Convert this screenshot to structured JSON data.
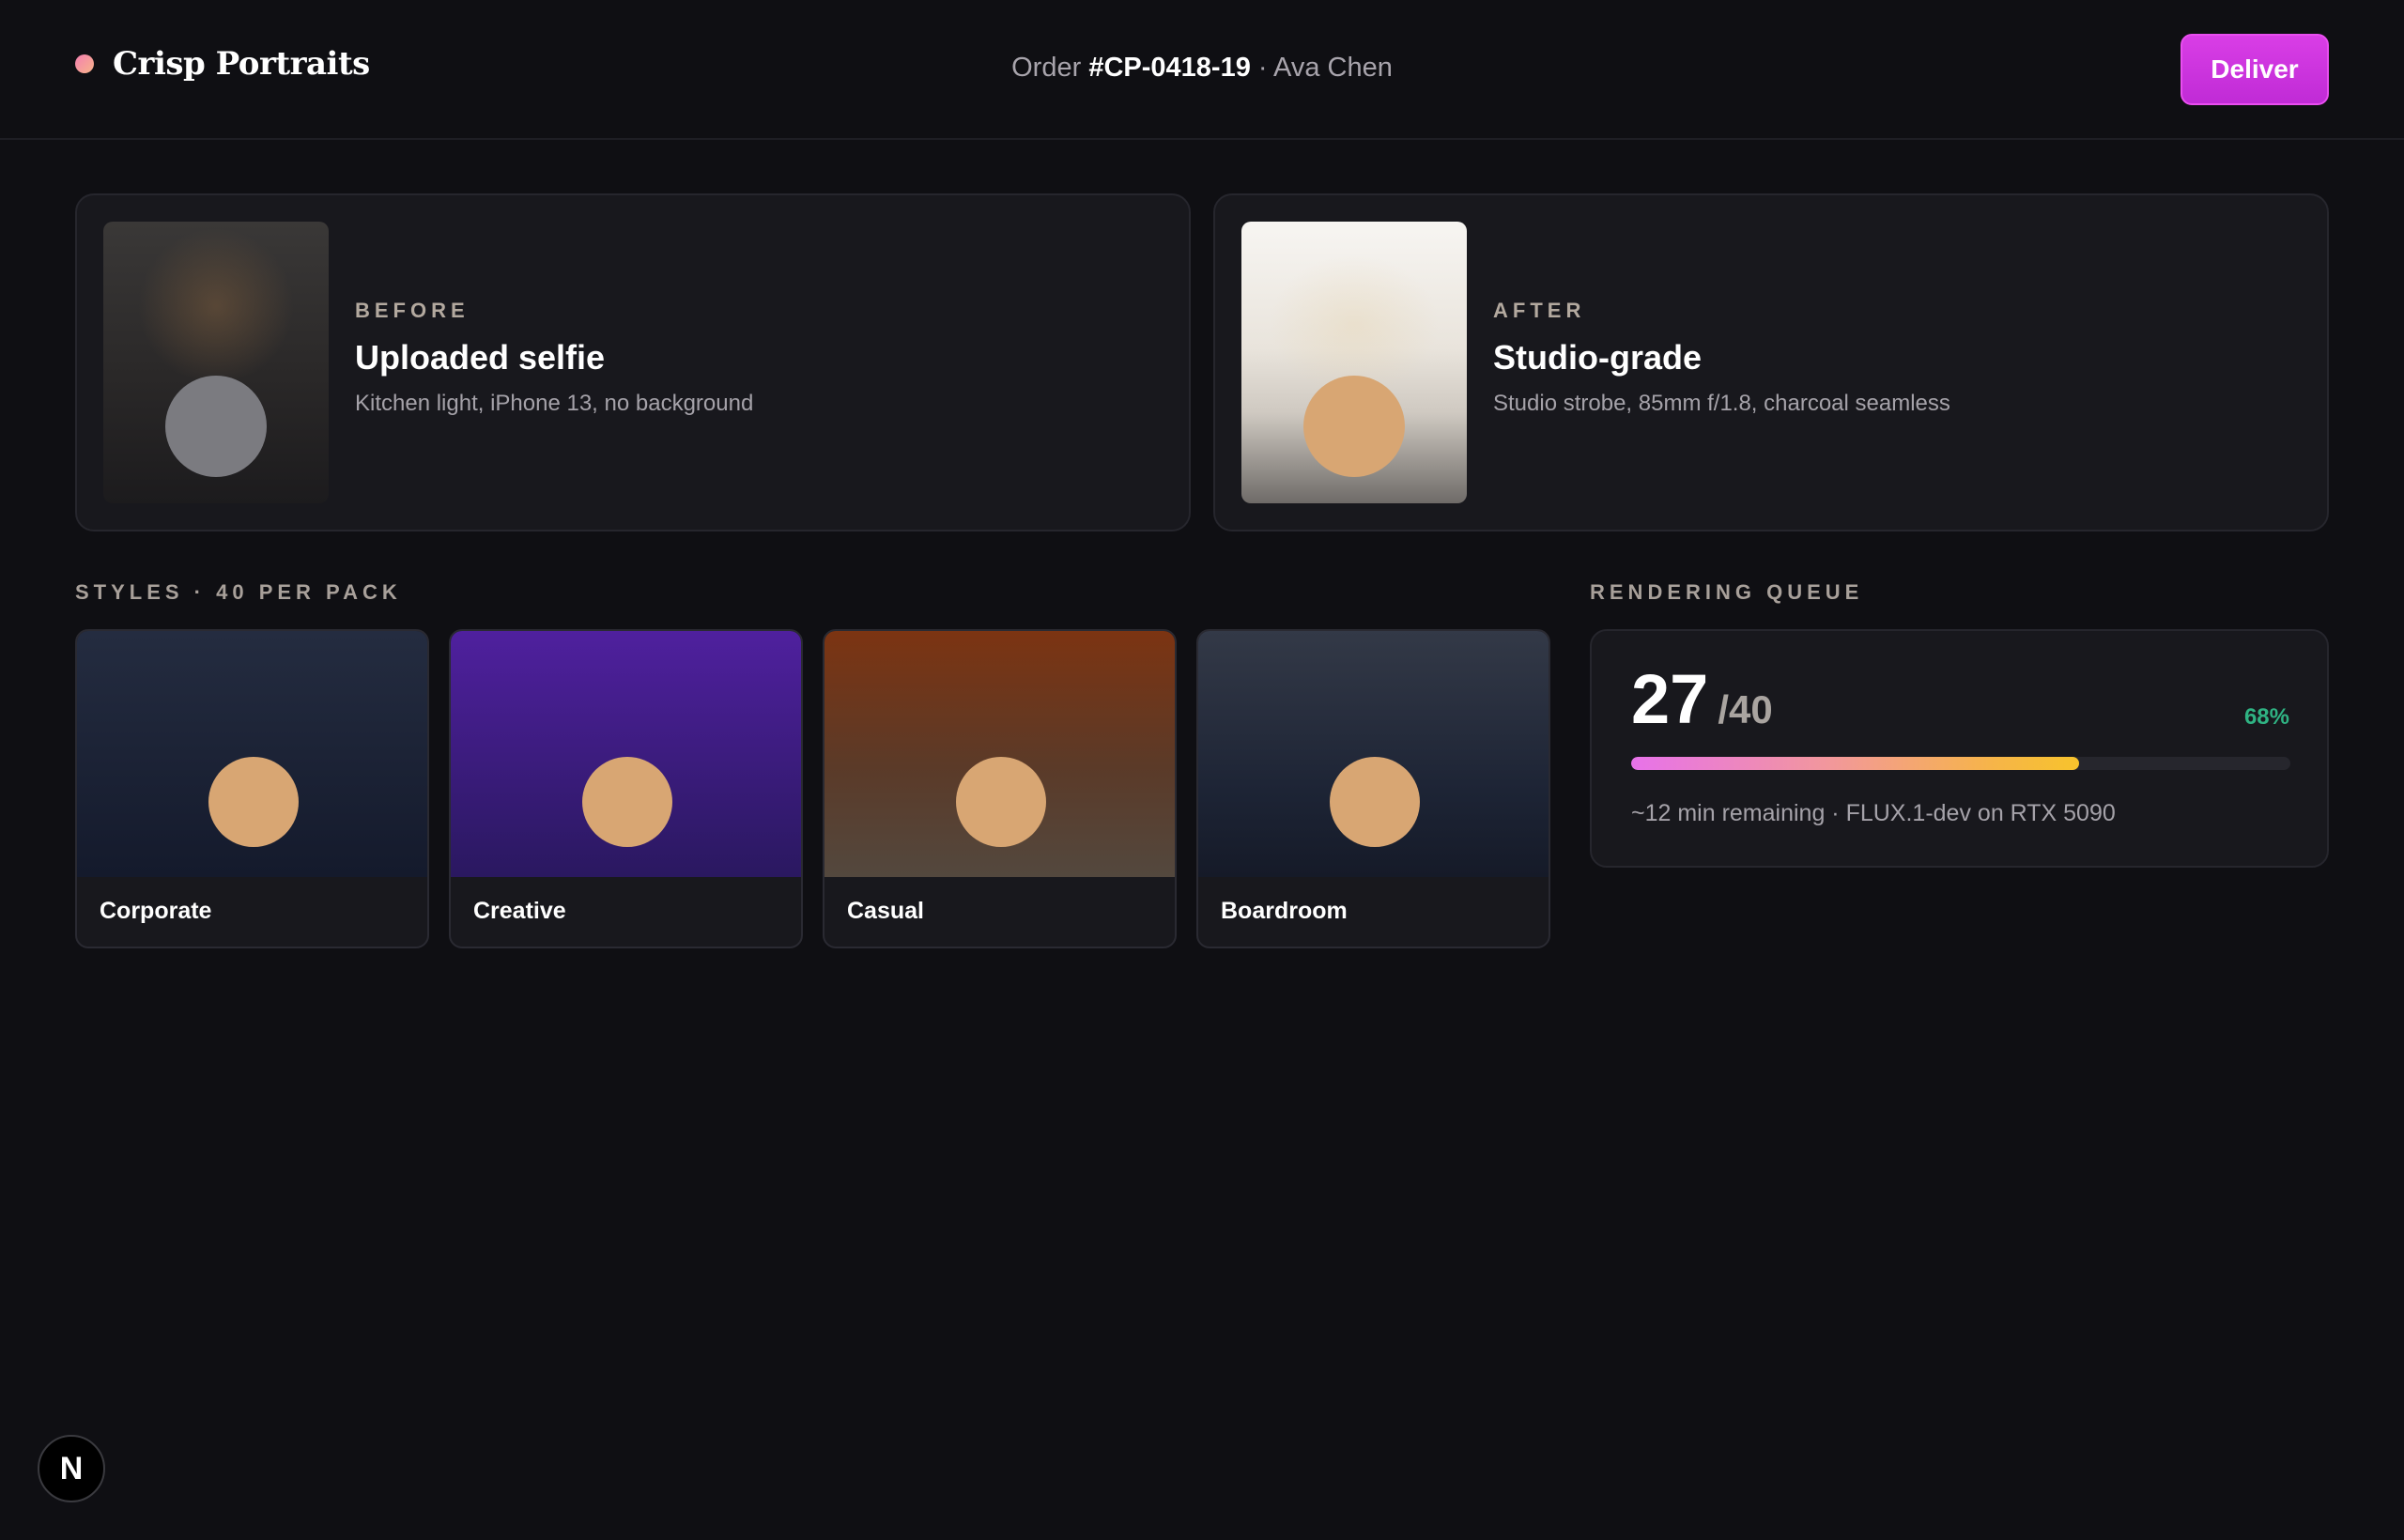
{
  "brand": {
    "name": "Crisp Portraits"
  },
  "order": {
    "prefix": "Order",
    "id": "#CP-0418-19",
    "separator": "·",
    "customer": "Ava Chen"
  },
  "header": {
    "deliver_label": "Deliver"
  },
  "before": {
    "eyebrow": "BEFORE",
    "title": "Uploaded selfie",
    "subtitle": "Kitchen light, iPhone 13, no background"
  },
  "after": {
    "eyebrow": "AFTER",
    "title": "Studio-grade",
    "subtitle": "Studio strobe, 85mm f/1.8, charcoal seamless"
  },
  "styles": {
    "label": "STYLES · 40 PER PACK",
    "items": [
      {
        "label": "Corporate"
      },
      {
        "label": "Creative"
      },
      {
        "label": "Casual"
      },
      {
        "label": "Boardroom"
      }
    ]
  },
  "queue": {
    "label": "RENDERING QUEUE",
    "done": "27",
    "total": "/40",
    "percent": "68%",
    "progress": 0.68,
    "meta": "~12 min remaining · FLUX.1-dev on RTX 5090"
  },
  "dev_badge": {
    "glyph": "N"
  },
  "colors": {
    "background": "#0f0f13",
    "accent": "#d93ee6",
    "success": "#2fb383"
  }
}
